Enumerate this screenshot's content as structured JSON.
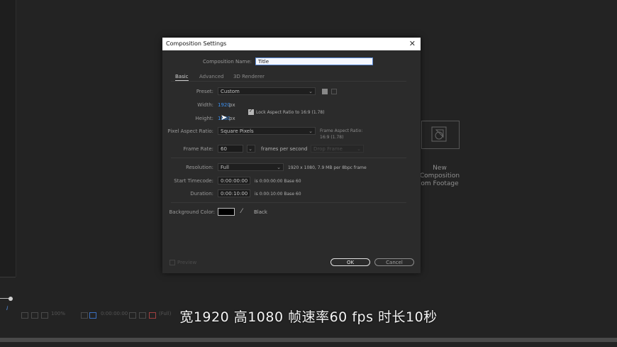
{
  "dialog": {
    "title": "Composition Settings",
    "comp_name_label": "Composition Name:",
    "comp_name_value": "Title",
    "tabs": [
      "Basic",
      "Advanced",
      "3D Renderer"
    ],
    "preset_label": "Preset:",
    "preset_value": "Custom",
    "width_label": "Width:",
    "width_value": "1920",
    "width_unit": "px",
    "height_label": "Height:",
    "height_value": "1080",
    "height_unit": "px",
    "lock_label": "Lock Aspect Ratio to 16:9 (1.78)",
    "par_label": "Pixel Aspect Ratio:",
    "par_value": "Square Pixels",
    "frame_aspect_label": "Frame Aspect Ratio:",
    "frame_aspect_value": "16:9 (1.78)",
    "framerate_label": "Frame Rate:",
    "framerate_value": "60",
    "framerate_unit": "frames per second",
    "drop_frame": "Drop Frame",
    "resolution_label": "Resolution:",
    "resolution_value": "Full",
    "resolution_info": "1920 x 1080, 7.9 MB per 8bpc frame",
    "start_tc_label": "Start Timecode:",
    "start_tc_value": "0:00:00:00",
    "start_tc_info": "is 0:00:00:00  Base 60",
    "duration_label": "Duration:",
    "duration_value": "0:00:10:00",
    "duration_info": "is 0:00:10:00  Base 60",
    "bg_label": "Background Color:",
    "bg_name": "Black",
    "bg_color": "#000000",
    "preview_label": "Preview",
    "ok_label": "OK",
    "cancel_label": "Cancel"
  },
  "new_comp": {
    "line1": "New",
    "line2": "Composition",
    "line3": "om Footage"
  },
  "bottom_bar": {
    "zoom": "100%",
    "timecode": "0:00:00:00",
    "res": "(Full)"
  },
  "subtitle": "宽1920 高1080 帧速率60 fps 时长10秒"
}
